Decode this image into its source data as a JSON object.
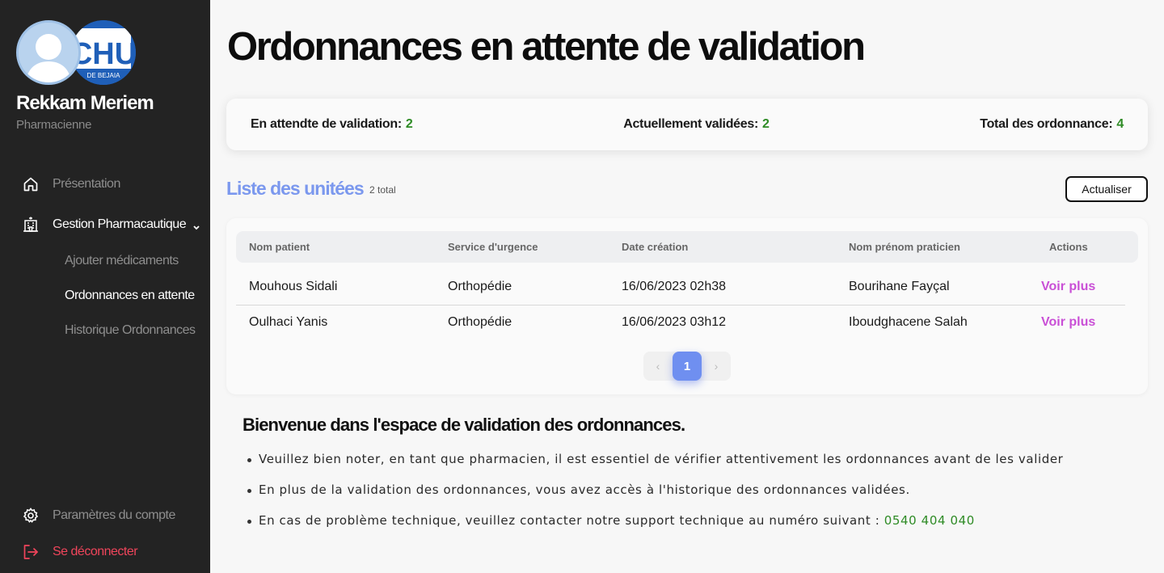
{
  "sidebar": {
    "user": {
      "name": "Rekkam Meriem",
      "role": "Pharmacienne"
    },
    "logo_text": "CHU",
    "logo_subtext": "DE BEJAIA",
    "items": [
      {
        "label": "Présentation",
        "icon": "home-icon"
      },
      {
        "label": "Gestion Pharmacautique",
        "icon": "hospital-icon",
        "expanded": true
      }
    ],
    "subitems": [
      {
        "label": "Ajouter médicaments"
      },
      {
        "label": "Ordonnances en attente",
        "active": true
      },
      {
        "label": "Historique Ordonnances"
      }
    ],
    "settings": {
      "label": "Paramètres du compte",
      "icon": "gear-icon"
    },
    "logout": {
      "label": "Se déconnecter",
      "icon": "logout-icon"
    }
  },
  "main": {
    "title": "Ordonnances en attente de validation",
    "stats": {
      "pending_label": "En attendte de validation:",
      "pending_value": "2",
      "validated_label": "Actuellement validées:",
      "validated_value": "2",
      "total_label": "Total des ordonnance:",
      "total_value": "4"
    },
    "list": {
      "title": "Liste des unitées",
      "count": "2 total",
      "refresh_label": "Actualiser",
      "columns": [
        "Nom patient",
        "Service d'urgence",
        "Date création",
        "Nom prénom praticien",
        "Actions"
      ],
      "rows": [
        {
          "patient": "Mouhous Sidali",
          "service": "Orthopédie",
          "date": "16/06/2023 02h38",
          "practitioner": "Bourihane Fayçal",
          "action": "Voir plus"
        },
        {
          "patient": "Oulhaci Yanis",
          "service": "Orthopédie",
          "date": "16/06/2023 03h12",
          "practitioner": "Iboudghacene Salah",
          "action": "Voir plus"
        }
      ],
      "pagination": {
        "current": "1",
        "prev": "‹",
        "next": "›"
      }
    },
    "welcome": {
      "title": "Bienvenue dans l'espace de validation des ordonnances.",
      "notes": [
        "Veuillez bien noter, en tant que pharmacien, il est essentiel de vérifier attentivement les ordonnances avant de les valider",
        "En plus de la validation des ordonnances, vous avez accès à l'historique des ordonnances validées."
      ],
      "support_text": "En cas de problème technique, veuillez contacter notre support technique au numéro suivant :",
      "support_phone": "0540 404 040"
    }
  },
  "colors": {
    "sidebar_bg": "#232323",
    "accent_blue": "#7b98ee",
    "success_green": "#2e8b25",
    "link_purple": "#c94fd6",
    "logout_red": "#f0455b"
  }
}
